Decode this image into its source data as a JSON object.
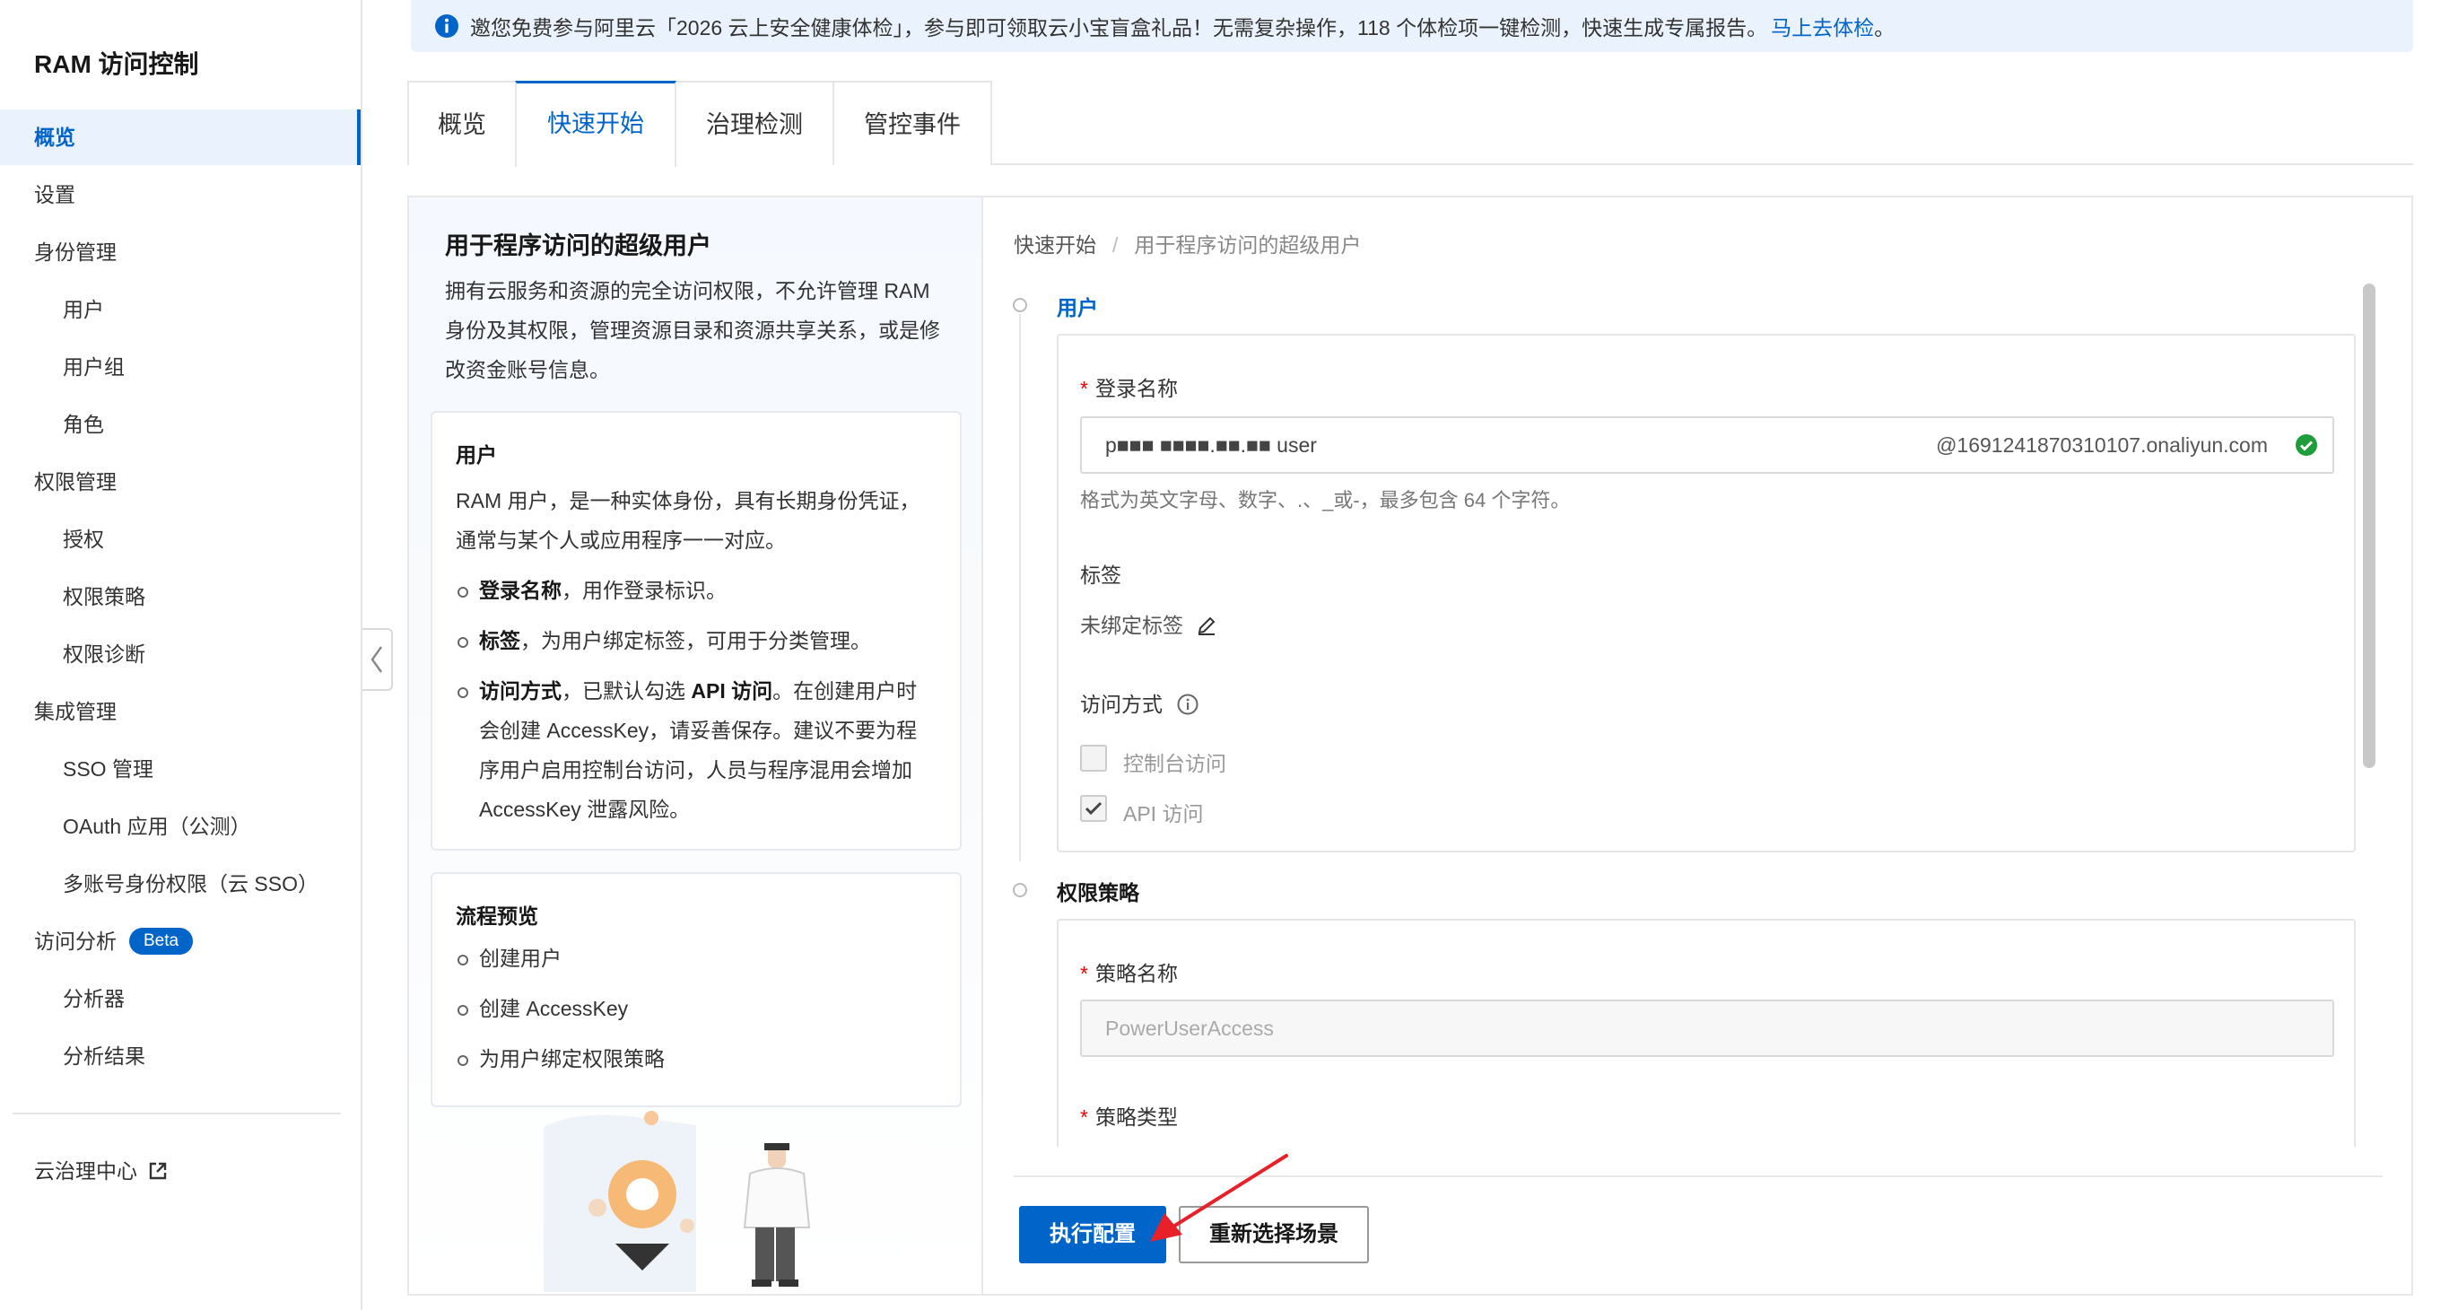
{
  "sidebar": {
    "title": "RAM 访问控制",
    "items": [
      {
        "label": "概览",
        "level": 1,
        "active": true
      },
      {
        "label": "设置",
        "level": 1
      },
      {
        "label": "身份管理",
        "level": 1
      },
      {
        "label": "用户",
        "level": 2
      },
      {
        "label": "用户组",
        "level": 2
      },
      {
        "label": "角色",
        "level": 2
      },
      {
        "label": "权限管理",
        "level": 1
      },
      {
        "label": "授权",
        "level": 2
      },
      {
        "label": "权限策略",
        "level": 2
      },
      {
        "label": "权限诊断",
        "level": 2
      },
      {
        "label": "集成管理",
        "level": 1
      },
      {
        "label": "SSO 管理",
        "level": 2
      },
      {
        "label": "OAuth 应用（公测）",
        "level": 2
      },
      {
        "label": "多账号身份权限（云 SSO）",
        "level": 2
      },
      {
        "label": "访问分析",
        "level": 1,
        "badge": "Beta"
      },
      {
        "label": "分析器",
        "level": 2
      },
      {
        "label": "分析结果",
        "level": 2
      }
    ],
    "footer_link": "云治理中心"
  },
  "banner": {
    "text": "邀您免费参与阿里云「2026 云上安全健康体检」，参与即可领取云小宝盲盒礼品！无需复杂操作，118 个体检项一键检测，快速生成专属报告。",
    "link": "马上去体检",
    "suffix": "。"
  },
  "tabs": [
    {
      "label": "概览"
    },
    {
      "label": "快速开始",
      "active": true
    },
    {
      "label": "治理检测"
    },
    {
      "label": "管控事件"
    }
  ],
  "left_panel": {
    "title": "用于程序访问的超级用户",
    "description": "拥有云服务和资源的完全访问权限，不允许管理 RAM 身份及其权限，管理资源目录和资源共享关系，或是修改资金账号信息。",
    "user_card": {
      "title": "用户",
      "text": "RAM 用户，是一种实体身份，具有长期身份凭证，通常与某个人或应用程序一一对应。",
      "bullets": [
        {
          "bold": "登录名称",
          "text": "，用作登录标识。"
        },
        {
          "bold": "标签",
          "text": "，为用户绑定标签，可用于分类管理。"
        },
        {
          "bold": "访问方式",
          "text": "，已默认勾选 ",
          "bold2": "API 访问",
          "text2": "。在创建用户时会创建 AccessKey，请妥善保存。建议不要为程序用户启用控制台访问，人员与程序混用会增加 AccessKey 泄露风险。"
        }
      ]
    },
    "flow_card": {
      "title": "流程预览",
      "steps": [
        "创建用户",
        "创建 AccessKey",
        "为用户绑定权限策略"
      ]
    }
  },
  "breadcrumb": {
    "root": "快速开始",
    "separator": "/",
    "current": "用于程序访问的超级用户"
  },
  "steps": {
    "user": {
      "label": "用户",
      "login_name_label": "登录名称",
      "login_name_value": "p■■■ ■■■■.■■.■■ user",
      "login_name_suffix": "@1691241870310107.onaliyun.com",
      "login_name_hint": "格式为英文字母、数字、.、_或-，最多包含 64 个字符。",
      "tag_label": "标签",
      "tag_value": "未绑定标签",
      "access_label": "访问方式",
      "console_access": "控制台访问",
      "api_access": "API 访问"
    },
    "policy": {
      "label": "权限策略",
      "policy_name_label": "策略名称",
      "policy_name_value": "PowerUserAccess",
      "policy_type_label": "策略类型"
    }
  },
  "actions": {
    "execute": "执行配置",
    "reselect": "重新选择场景"
  },
  "colors": {
    "accent": "#0064c8",
    "success": "#1f9d3a",
    "required": "#e00000",
    "annotation_arrow": "#e8202a"
  }
}
